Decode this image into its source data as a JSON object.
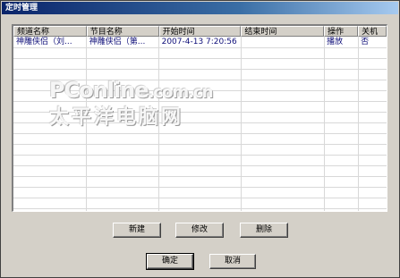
{
  "window": {
    "title": "定时管理"
  },
  "list": {
    "columns": [
      "频道名称",
      "节目名称",
      "开始时间",
      "结束时间",
      "操作",
      "关机"
    ],
    "rows": [
      [
        "神雕侠侣（刘...",
        "神雕侠侣（第...",
        "2007-4-13 7:20:56",
        "",
        "播放",
        "否"
      ]
    ]
  },
  "watermark": {
    "brand": "PConline",
    "domain": ".com.cn",
    "subtitle": "太平洋电脑网"
  },
  "buttons": {
    "new": "新建",
    "edit": "修改",
    "delete": "删除",
    "ok": "确定",
    "cancel": "取消"
  },
  "colors": {
    "title_bar": "#0a246a",
    "row_text": "#10107a",
    "dialog_bg": "#d4d0c8"
  }
}
